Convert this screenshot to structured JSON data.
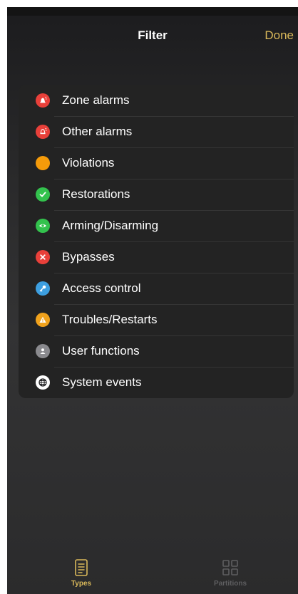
{
  "nav": {
    "title": "Filter",
    "done_label": "Done"
  },
  "filters": [
    {
      "label": "Zone alarms",
      "icon": "alarm-bell-icon",
      "color": "#e8403a"
    },
    {
      "label": "Other alarms",
      "icon": "alarm-bell-outline-icon",
      "color": "#e8403a"
    },
    {
      "label": "Violations",
      "icon": "orange-dot-icon",
      "color": "#f59b0a"
    },
    {
      "label": "Restorations",
      "icon": "checkmark-icon",
      "color": "#33c24d"
    },
    {
      "label": "Arming/Disarming",
      "icon": "eye-icon",
      "color": "#33c24d"
    },
    {
      "label": "Bypasses",
      "icon": "cross-icon",
      "color": "#e8403a"
    },
    {
      "label": "Access control",
      "icon": "key-icon",
      "color": "#3d9fe0"
    },
    {
      "label": "Troubles/Restarts",
      "icon": "warning-icon",
      "color": "#f0a21c"
    },
    {
      "label": "User functions",
      "icon": "user-icon",
      "color": "#8a8a8e"
    },
    {
      "label": "System events",
      "icon": "globe-icon",
      "color": "#ffffff"
    }
  ],
  "tabs": [
    {
      "label": "Types",
      "icon": "document-list-icon",
      "active": true
    },
    {
      "label": "Partitions",
      "icon": "grid-squares-icon",
      "active": false
    }
  ],
  "colors": {
    "accent": "#d9b85a",
    "list_background": "#232323"
  }
}
